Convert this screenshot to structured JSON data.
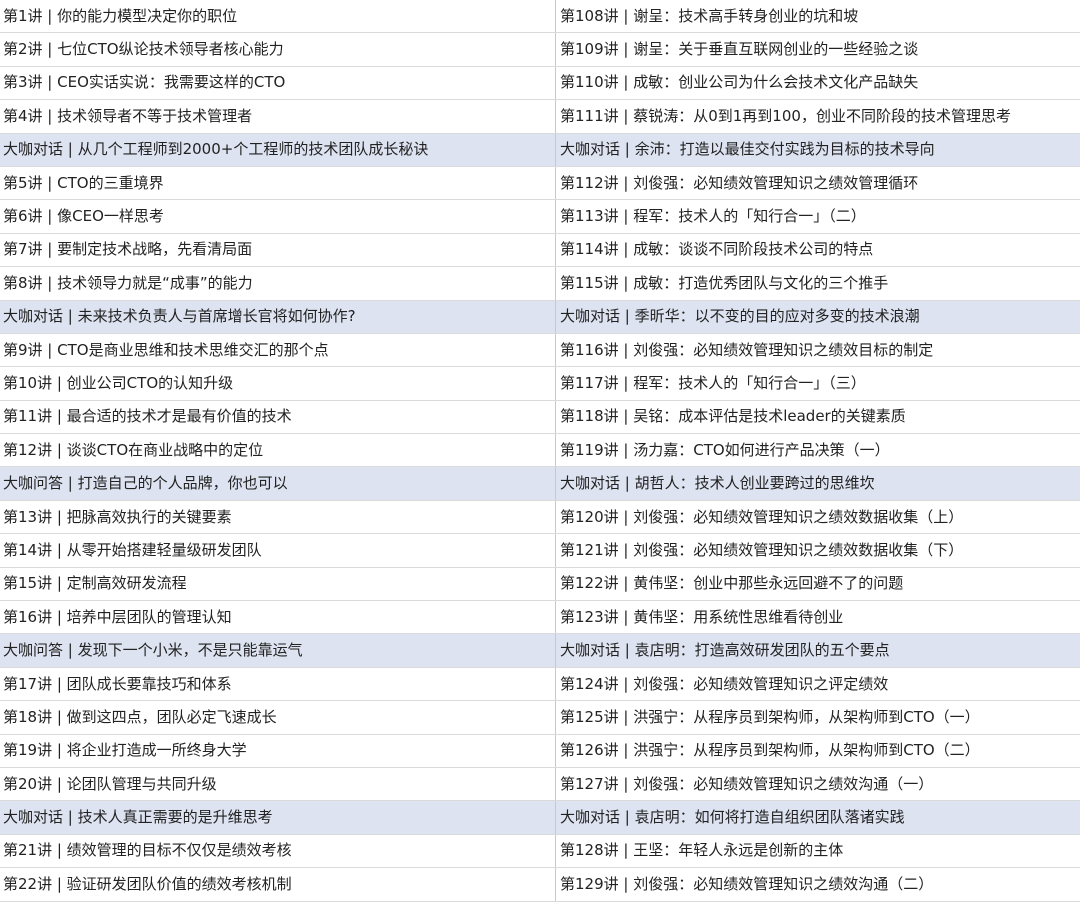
{
  "rows": [
    {
      "left": "第1讲 | 你的能力模型决定你的职位",
      "right": "第108讲 | 谢呈：技术高手转身创业的坑和坡",
      "highlight": false
    },
    {
      "left": "第2讲 | 七位CTO纵论技术领导者核心能力",
      "right": "第109讲 | 谢呈：关于垂直互联网创业的一些经验之谈",
      "highlight": false
    },
    {
      "left": "第3讲 | CEO实话实说：我需要这样的CTO",
      "right": "第110讲 | 成敏：创业公司为什么会技术文化产品缺失",
      "highlight": false
    },
    {
      "left": "第4讲 | 技术领导者不等于技术管理者",
      "right": "第111讲 | 蔡锐涛：从0到1再到100，创业不同阶段的技术管理思考",
      "highlight": false
    },
    {
      "left": "大咖对话 | 从几个工程师到2000+个工程师的技术团队成长秘诀",
      "right": "大咖对话 | 余沛：打造以最佳交付实践为目标的技术导向",
      "highlight": true
    },
    {
      "left": "第5讲 | CTO的三重境界",
      "right": "第112讲 | 刘俊强：必知绩效管理知识之绩效管理循环",
      "highlight": false
    },
    {
      "left": "第6讲 | 像CEO一样思考",
      "right": "第113讲 | 程军：技术人的「知行合一」（二）",
      "highlight": false
    },
    {
      "left": "第7讲 | 要制定技术战略，先看清局面",
      "right": "第114讲 | 成敏：谈谈不同阶段技术公司的特点",
      "highlight": false
    },
    {
      "left": "第8讲 | 技术领导力就是“成事”的能力",
      "right": "第115讲 | 成敏：打造优秀团队与文化的三个推手",
      "highlight": false
    },
    {
      "left": "大咖对话 | 未来技术负责人与首席增长官将如何协作?",
      "right": "大咖对话 | 季昕华：以不变的目的应对多变的技术浪潮",
      "highlight": true
    },
    {
      "left": "第9讲 | CTO是商业思维和技术思维交汇的那个点",
      "right": "第116讲 | 刘俊强：必知绩效管理知识之绩效目标的制定",
      "highlight": false
    },
    {
      "left": "第10讲 | 创业公司CTO的认知升级",
      "right": "第117讲 | 程军：技术人的「知行合一」（三）",
      "highlight": false
    },
    {
      "left": "第11讲 | 最合适的技术才是最有价值的技术",
      "right": "第118讲 | 吴铭：成本评估是技术leader的关键素质",
      "highlight": false
    },
    {
      "left": "第12讲 | 谈谈CTO在商业战略中的定位",
      "right": "第119讲 | 汤力嘉：CTO如何进行产品决策（一）",
      "highlight": false
    },
    {
      "left": "大咖问答 | 打造自己的个人品牌，你也可以",
      "right": "大咖对话 | 胡哲人：技术人创业要跨过的思维坎",
      "highlight": true
    },
    {
      "left": "第13讲 | 把脉高效执行的关键要素",
      "right": "第120讲 | 刘俊强：必知绩效管理知识之绩效数据收集（上）",
      "highlight": false
    },
    {
      "left": "第14讲 | 从零开始搭建轻量级研发团队",
      "right": "第121讲 | 刘俊强：必知绩效管理知识之绩效数据收集（下）",
      "highlight": false
    },
    {
      "left": "第15讲 | 定制高效研发流程",
      "right": "第122讲 | 黄伟坚：创业中那些永远回避不了的问题",
      "highlight": false
    },
    {
      "left": "第16讲 | 培养中层团队的管理认知",
      "right": "第123讲 | 黄伟坚：用系统性思维看待创业",
      "highlight": false
    },
    {
      "left": "大咖问答 | 发现下一个小米，不是只能靠运气",
      "right": "大咖对话 | 袁店明：打造高效研发团队的五个要点",
      "highlight": true
    },
    {
      "left": "第17讲 | 团队成长要靠技巧和体系",
      "right": "第124讲 | 刘俊强：必知绩效管理知识之评定绩效",
      "highlight": false
    },
    {
      "left": "第18讲 | 做到这四点，团队必定飞速成长",
      "right": "第125讲 | 洪强宁：从程序员到架构师，从架构师到CTO（一）",
      "highlight": false
    },
    {
      "left": "第19讲 | 将企业打造成一所终身大学",
      "right": "第126讲 | 洪强宁：从程序员到架构师，从架构师到CTO（二）",
      "highlight": false
    },
    {
      "left": "第20讲 | 论团队管理与共同升级",
      "right": "第127讲 | 刘俊强：必知绩效管理知识之绩效沟通（一）",
      "highlight": false
    },
    {
      "left": "大咖对话 | 技术人真正需要的是升维思考",
      "right": "大咖对话 | 袁店明：如何将打造自组织团队落诸实践",
      "highlight": true
    },
    {
      "left": "第21讲 | 绩效管理的目标不仅仅是绩效考核",
      "right": "第128讲 | 王坚：年轻人永远是创新的主体",
      "highlight": false
    },
    {
      "left": "第22讲 | 验证研发团队价值的绩效考核机制",
      "right": "第129讲 | 刘俊强：必知绩效管理知识之绩效沟通（二）",
      "highlight": false
    }
  ]
}
